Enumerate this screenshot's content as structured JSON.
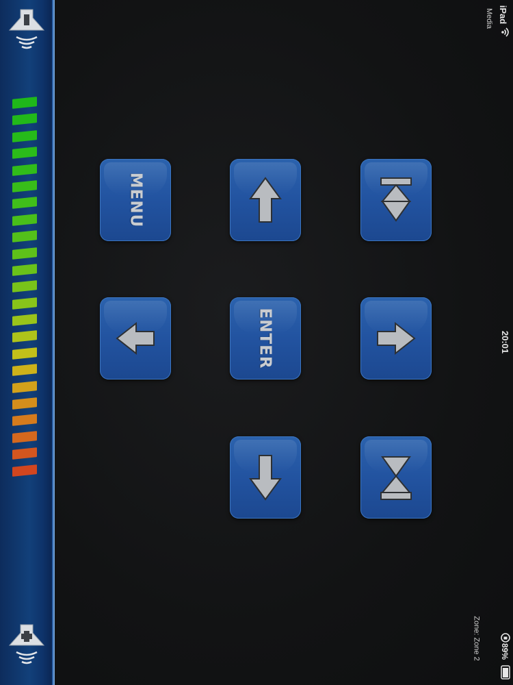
{
  "status_bar": {
    "device": "iPad",
    "carrier": "Media",
    "time": "20:01",
    "zone_label": "Zone: Zone 2",
    "battery": "89%"
  },
  "volume": {
    "down_icon": "speaker-minus-icon",
    "up_icon": "speaker-plus-icon",
    "level_bar_colors": [
      "#1fb81a",
      "#22b91a",
      "#26ba1a",
      "#2bbb1a",
      "#31bc1a",
      "#38bd1a",
      "#40be1a",
      "#49bf1a",
      "#53c01a",
      "#5ec11a",
      "#6ac21a",
      "#78c31a",
      "#88c41a",
      "#9ac41a",
      "#aec31a",
      "#c2c01a",
      "#cdb21a",
      "#d2a11b",
      "#d48e1c",
      "#d57b1d",
      "#d5681e",
      "#d4561f",
      "#d2461f"
    ]
  },
  "keypad": {
    "menu_label": "MENU",
    "enter_label": "ENTER",
    "up_icon": "arrow-up-icon",
    "left_icon": "arrow-left-icon",
    "right_icon": "arrow-right-icon",
    "down_icon": "arrow-down-icon",
    "previous_icon": "skip-previous-icon",
    "next_icon": "skip-next-icon",
    "key_color": "#2558a5",
    "glyph_color": "#b9bcc0"
  }
}
